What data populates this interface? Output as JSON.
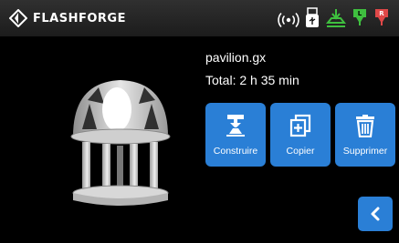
{
  "header": {
    "brand": "FLASHFORGE",
    "status_icons": [
      "wifi-icon",
      "usb-icon",
      "platform-icon",
      "nozzle-left-icon",
      "nozzle-right-icon"
    ]
  },
  "file": {
    "name": "pavilion.gx",
    "total_label": "Total:",
    "total_value": "2 h 35 min"
  },
  "actions": {
    "build_label": "Construire",
    "copy_label": "Copier",
    "delete_label": "Supprimer"
  },
  "colors": {
    "accent": "#2a7fd6",
    "background": "#000000",
    "topbar": "#262626",
    "status_green": "#3fbf3f",
    "status_red": "#e04848"
  },
  "icons": {
    "back": "chevron-left-icon",
    "build": "build-icon",
    "copy": "copy-icon",
    "delete": "trash-icon"
  }
}
